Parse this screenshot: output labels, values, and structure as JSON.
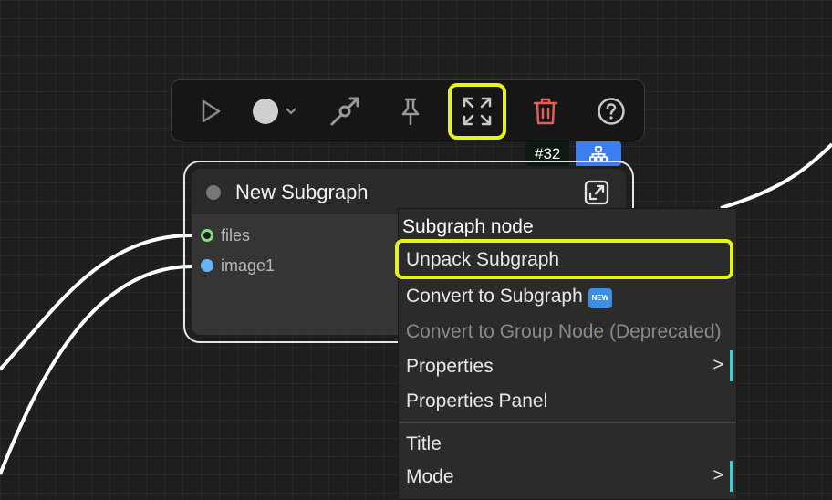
{
  "toolbar": {
    "buttons": [
      {
        "id": "run",
        "icon": "play-icon"
      },
      {
        "id": "color",
        "icon": "color-circle-icon",
        "color": "#cfcfcf"
      },
      {
        "id": "bypass",
        "icon": "bypass-icon"
      },
      {
        "id": "pin",
        "icon": "pin-icon"
      },
      {
        "id": "expand",
        "icon": "expand-icon",
        "highlighted": true
      },
      {
        "id": "delete",
        "icon": "trash-icon",
        "color": "#e35d5d"
      },
      {
        "id": "help",
        "icon": "help-icon"
      }
    ]
  },
  "node": {
    "id_badge": "#32",
    "badge_icon": "subgraph-hierarchy-icon",
    "title": "New Subgraph",
    "inputs": [
      {
        "label": "files",
        "color": "#7fe07f"
      },
      {
        "label": "image1",
        "color": "#67b4f5"
      }
    ]
  },
  "context_menu": {
    "header": "Subgraph node",
    "items": [
      {
        "label": "Unpack Subgraph",
        "highlighted": true
      },
      {
        "label": "Convert to Subgraph",
        "badge": "NEW"
      },
      {
        "label": "Convert to Group Node (Deprecated)",
        "disabled": true
      },
      {
        "label": "Properties",
        "submenu": ">"
      },
      {
        "label": "Properties Panel"
      },
      {
        "label": "Title"
      },
      {
        "label": "Mode",
        "submenu": ">"
      }
    ]
  },
  "colors": {
    "highlight": "#e8f21c",
    "accent_blue": "#3c7ef0",
    "submenu_bar": "#3ad1d1"
  }
}
